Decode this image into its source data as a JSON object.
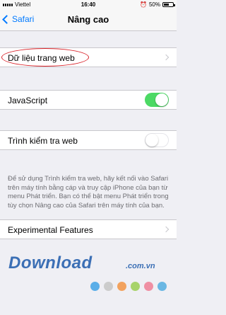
{
  "status_bar": {
    "carrier": "Viettel",
    "time": "16:40",
    "battery": "50%"
  },
  "nav": {
    "back_label": "Safari",
    "title": "Nâng cao"
  },
  "rows": {
    "website_data": {
      "label": "Dữ liệu trang web"
    },
    "javascript": {
      "label": "JavaScript",
      "enabled": true
    },
    "web_inspector": {
      "label": "Trình kiểm tra web",
      "enabled": false
    },
    "experimental": {
      "label": "Experimental Features"
    }
  },
  "footer_text": "Để sử dụng Trình kiểm tra web, hãy kết nối vào Safari trên máy tính bằng cáp và truy cập iPhone của bạn từ menu Phát triển. Bạn có thể bật menu Phát triển trong tùy chọn Nâng cao của Safari trên máy tính của bạn.",
  "watermark": {
    "text": "Download",
    "suffix": ".com.vn",
    "dot_colors": [
      "#5aaee8",
      "#cccccc",
      "#f2a25e",
      "#a7d36a",
      "#ef8fa3",
      "#6ab7e3"
    ]
  },
  "colors": {
    "accent": "#007aff",
    "toggle_on": "#4cd964",
    "highlight_oval": "#d9232a"
  }
}
